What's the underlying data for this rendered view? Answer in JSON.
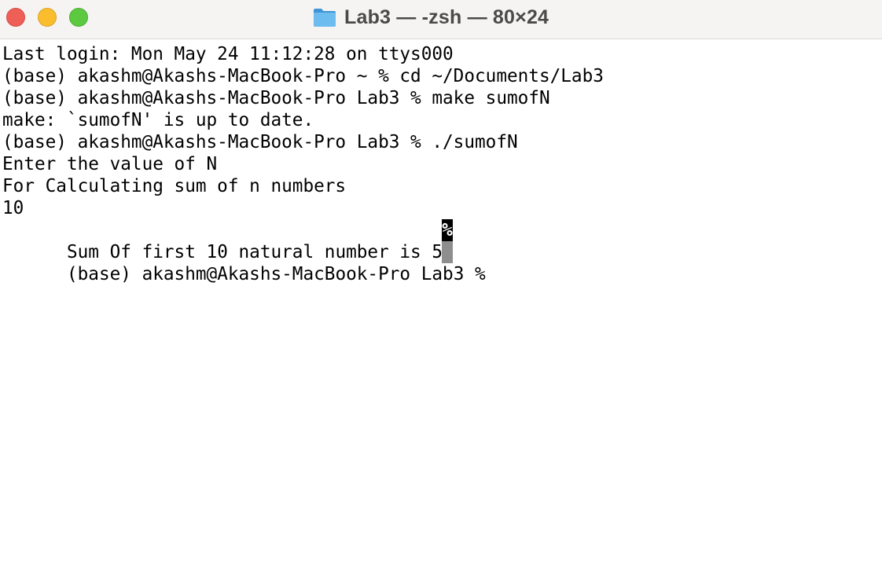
{
  "window": {
    "title": "Lab3 — -zsh — 80×24",
    "folder_icon": "folder-icon",
    "controls": {
      "close": "close-icon",
      "minimize": "minimize-icon",
      "zoom": "zoom-icon"
    },
    "colors": {
      "close": "#ee5f58",
      "minimize": "#f9bd2e",
      "zoom": "#5dc941",
      "folder": "#5fb3e8"
    }
  },
  "terminal": {
    "lines": [
      "Last login: Mon May 24 11:12:28 on ttys000",
      "(base) akashm@Akashs-MacBook-Pro ~ % cd ~/Documents/Lab3",
      "(base) akashm@Akashs-MacBook-Pro Lab3 % make sumofN",
      "make: `sumofN' is up to date.",
      "(base) akashm@Akashs-MacBook-Pro Lab3 % ./sumofN",
      "Enter the value of N",
      "For Calculating sum of n numbers",
      "10",
      "Sum Of first 10 natural number is 55",
      "(base) akashm@Akashs-MacBook-Pro Lab3 % "
    ],
    "eol_marker": "%",
    "cursor_color": "#8e8e8e"
  }
}
